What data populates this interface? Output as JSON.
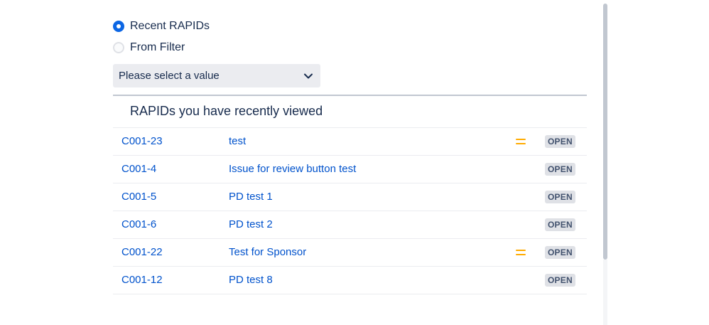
{
  "source_options": [
    {
      "label": "Recent RAPIDs",
      "selected": true
    },
    {
      "label": "From Filter",
      "selected": false
    }
  ],
  "select": {
    "placeholder": "Please select a value",
    "icon": "chevron-down-icon"
  },
  "section": {
    "title": "RAPIDs you have recently viewed"
  },
  "issues": [
    {
      "key": "C001-23",
      "summary": "test",
      "priority": "medium",
      "status": "OPEN"
    },
    {
      "key": "C001-4",
      "summary": "Issue for review button test",
      "priority": null,
      "status": "OPEN"
    },
    {
      "key": "C001-5",
      "summary": "PD test 1",
      "priority": null,
      "status": "OPEN"
    },
    {
      "key": "C001-6",
      "summary": "PD test 2",
      "priority": null,
      "status": "OPEN"
    },
    {
      "key": "C001-22",
      "summary": "Test for Sponsor",
      "priority": "medium",
      "status": "OPEN"
    },
    {
      "key": "C001-12",
      "summary": "PD test 8",
      "priority": null,
      "status": "OPEN"
    }
  ],
  "colors": {
    "accent": "#0c66e4",
    "link": "#0052cc",
    "priority_medium": "#ffab00",
    "status_bg": "#dfe1e6",
    "status_text": "#42526e"
  }
}
